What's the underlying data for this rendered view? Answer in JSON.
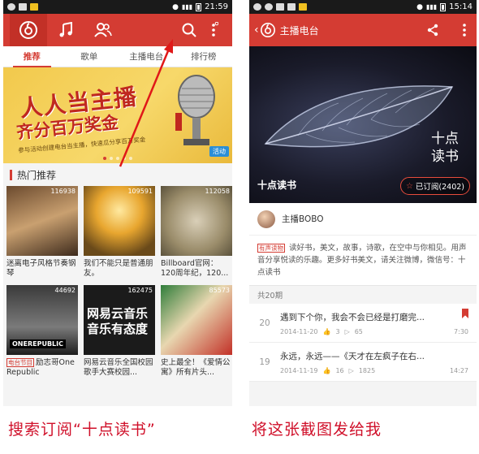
{
  "left": {
    "status": {
      "time": "21:59"
    },
    "subtabs": [
      "推荐",
      "歌单",
      "主播电台",
      "排行榜"
    ],
    "banner": {
      "line1": "人人当主播",
      "line2": "齐分百万奖金",
      "small": "参与活动创建电台当主播，快速瓜分享百万奖金",
      "badge": "活动"
    },
    "section_title": "热门推荐",
    "cards": [
      {
        "plays": "116938",
        "title": "迷离电子风格节奏钢琴",
        "tag": ""
      },
      {
        "plays": "109591",
        "title": "我们不能只是普通朋友。",
        "tag": ""
      },
      {
        "plays": "112058",
        "title": "Billboard官网：120周年纪，120...",
        "tag": ""
      },
      {
        "plays": "44692",
        "title": "励志哥One Republic",
        "tag": "电台节目"
      },
      {
        "plays": "162475",
        "title": "网易云音乐全国校园歌手大赛校园...",
        "tag": ""
      },
      {
        "plays": "85573",
        "title": "史上最全！《爱情公寓》所有片头...",
        "tag": ""
      }
    ],
    "card_art": [
      "",
      "",
      "",
      "ONEREPUBLIC",
      "网易云音乐 音乐有态度",
      ""
    ],
    "caption": "搜索订阅“十点读书”"
  },
  "right": {
    "status": {
      "time": "15:14"
    },
    "title": "主播电台",
    "hero_title": "十点读书",
    "hero_art": "十点\n读书",
    "subscribed": "已订阅(2402)",
    "host": "主播BOBO",
    "desc_tag": "有声读物",
    "desc": "读好书，美文，故事，诗歌，在空中与你相见。用声音分享悦读的乐趣。更多好书美文，请关注微博，微信号：十点读书",
    "count": "共20期",
    "episodes": [
      {
        "num": "20",
        "title": "遇到下个你，我会不会已经是打磨完...",
        "date": "2014-11-20",
        "likes": "3",
        "plays": "65",
        "duration": "7:30"
      },
      {
        "num": "19",
        "title": "永远，永远——《天才在左疯子在右...",
        "date": "2014-11-19",
        "likes": "16",
        "plays": "1825",
        "duration": "14:27"
      }
    ],
    "caption": "将这张截图发给我"
  },
  "colors": {
    "accent": "#d43c33",
    "caption": "#d0102a"
  }
}
